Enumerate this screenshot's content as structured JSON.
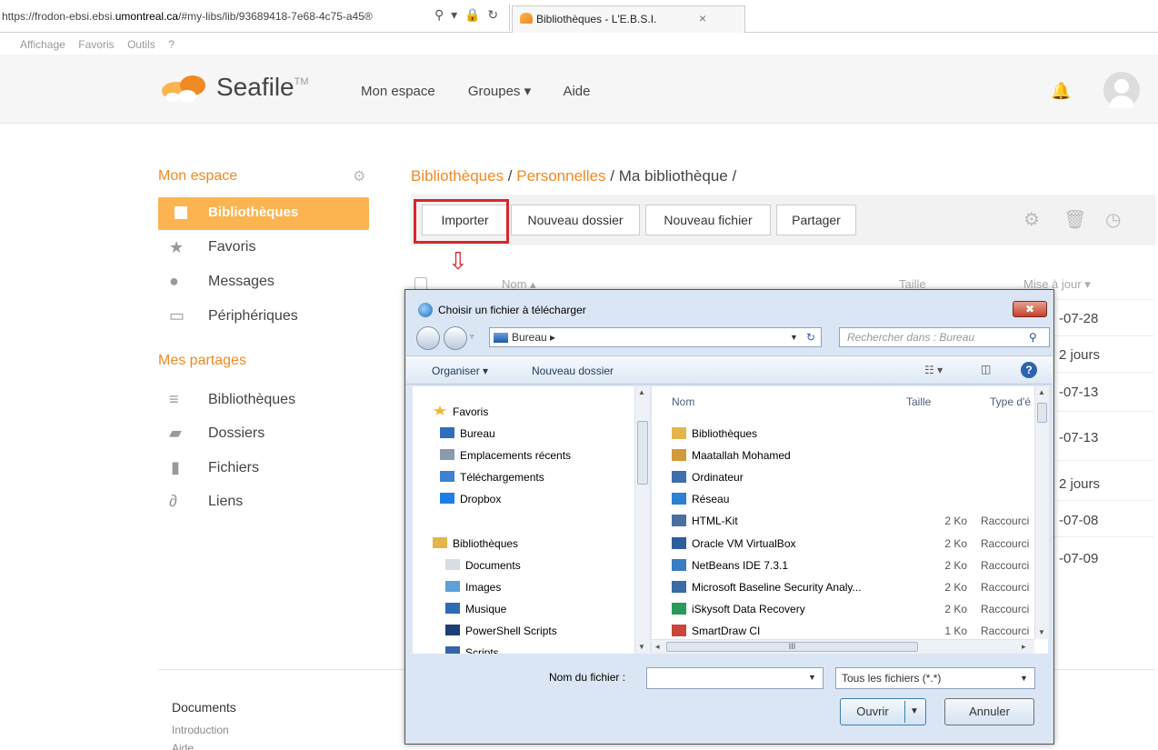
{
  "browser": {
    "url_prefix": "https://frodon-ebsi.ebsi.",
    "url_domain": "umontreal.ca",
    "url_suffix": "/#my-libs/lib/93689418-7e68-4c75-a45®",
    "tab_title": "Bibliothèques - L'E.B.S.I.",
    "tab_close": "×",
    "menu": [
      "Affichage",
      "Favoris",
      "Outils",
      "?"
    ]
  },
  "header": {
    "logo_text": "Seafile",
    "logo_tm": "TM",
    "nav": [
      "Mon espace",
      "Groupes ▾",
      "Aide"
    ]
  },
  "sidebar": {
    "section1_title": "Mon espace",
    "items1": [
      {
        "label": "Bibliothèques",
        "icon": "archive-icon"
      },
      {
        "label": "Favoris",
        "icon": "star-icon"
      },
      {
        "label": "Messages",
        "icon": "chat-icon"
      },
      {
        "label": "Périphériques",
        "icon": "monitor-icon"
      }
    ],
    "section2_title": "Mes partages",
    "items2": [
      {
        "label": "Bibliothèques",
        "icon": "archive-icon"
      },
      {
        "label": "Dossiers",
        "icon": "folder-icon"
      },
      {
        "label": "Fichiers",
        "icon": "file-icon"
      },
      {
        "label": "Liens",
        "icon": "link-icon"
      }
    ]
  },
  "main": {
    "crumb_libs": "Bibliothèques",
    "crumb_sep1": " / ",
    "crumb_personal": "Personnelles",
    "crumb_rest": " / Ma bibliothèque /",
    "buttons": [
      "Importer",
      "Nouveau dossier",
      "Nouveau fichier",
      "Partager"
    ],
    "col_name": "Nom ▴",
    "col_size": "Taille",
    "col_updated": "Mise à jour ▾",
    "dates": [
      "-07-28",
      "2 jours",
      "-07-13",
      "-07-13",
      "2 jours",
      "-07-08",
      "-07-09"
    ]
  },
  "footer": {
    "docs": "Documents",
    "intro": "Introduction",
    "aide": "Aide"
  },
  "dialog": {
    "title": "Choisir un fichier à télécharger",
    "close": "✖",
    "address": "Bureau ▸",
    "search_placeholder": "Rechercher dans : Bureau",
    "organize": "Organiser ▾",
    "new_folder": "Nouveau dossier",
    "nav_items": [
      {
        "label": "Favoris",
        "color": "#f2b632"
      },
      {
        "label": "Bureau",
        "color": "#2f6fbd"
      },
      {
        "label": "Emplacements récents",
        "color": "#8a9bb0"
      },
      {
        "label": "Téléchargements",
        "color": "#3f82cf"
      },
      {
        "label": "Dropbox",
        "color": "#1e7ee8"
      },
      {
        "label": "Bibliothèques",
        "color": "#e3b54b"
      },
      {
        "label": "Documents",
        "color": "#d8dde4"
      },
      {
        "label": "Images",
        "color": "#5fa0d8"
      },
      {
        "label": "Musique",
        "color": "#2d6bb3"
      },
      {
        "label": "PowerShell Scripts",
        "color": "#1c3f74"
      },
      {
        "label": "Scripts",
        "color": "#3565a8"
      }
    ],
    "col_name": "Nom",
    "col_size": "Taille",
    "col_type": "Type d'é",
    "files": [
      {
        "name": "Bibliothèques",
        "size": "",
        "type": "",
        "color": "#e3b54b"
      },
      {
        "name": "Maatallah Mohamed",
        "size": "",
        "type": "",
        "color": "#d39a3a"
      },
      {
        "name": "Ordinateur",
        "size": "",
        "type": "",
        "color": "#3d6fae"
      },
      {
        "name": "Réseau",
        "size": "",
        "type": "",
        "color": "#2c7fd1"
      },
      {
        "name": "HTML-Kit",
        "size": "2 Ko",
        "type": "Raccourci",
        "color": "#4a6fa0"
      },
      {
        "name": "Oracle VM VirtualBox",
        "size": "2 Ko",
        "type": "Raccourci",
        "color": "#2d5e9a"
      },
      {
        "name": "NetBeans IDE 7.3.1",
        "size": "2 Ko",
        "type": "Raccourci",
        "color": "#3a7cc4"
      },
      {
        "name": "Microsoft Baseline Security Analy...",
        "size": "2 Ko",
        "type": "Raccourci",
        "color": "#3b6aa5"
      },
      {
        "name": "iSkysoft Data Recovery",
        "size": "2 Ko",
        "type": "Raccourci",
        "color": "#2a9a5a"
      },
      {
        "name": "SmartDraw CI",
        "size": "1 Ko",
        "type": "Raccourci",
        "color": "#c8463a"
      }
    ],
    "filename_label": "Nom du fichier :",
    "filetype": "Tous les fichiers (*.*)",
    "open": "Ouvrir",
    "cancel": "Annuler",
    "hscroll_mark": "III"
  }
}
